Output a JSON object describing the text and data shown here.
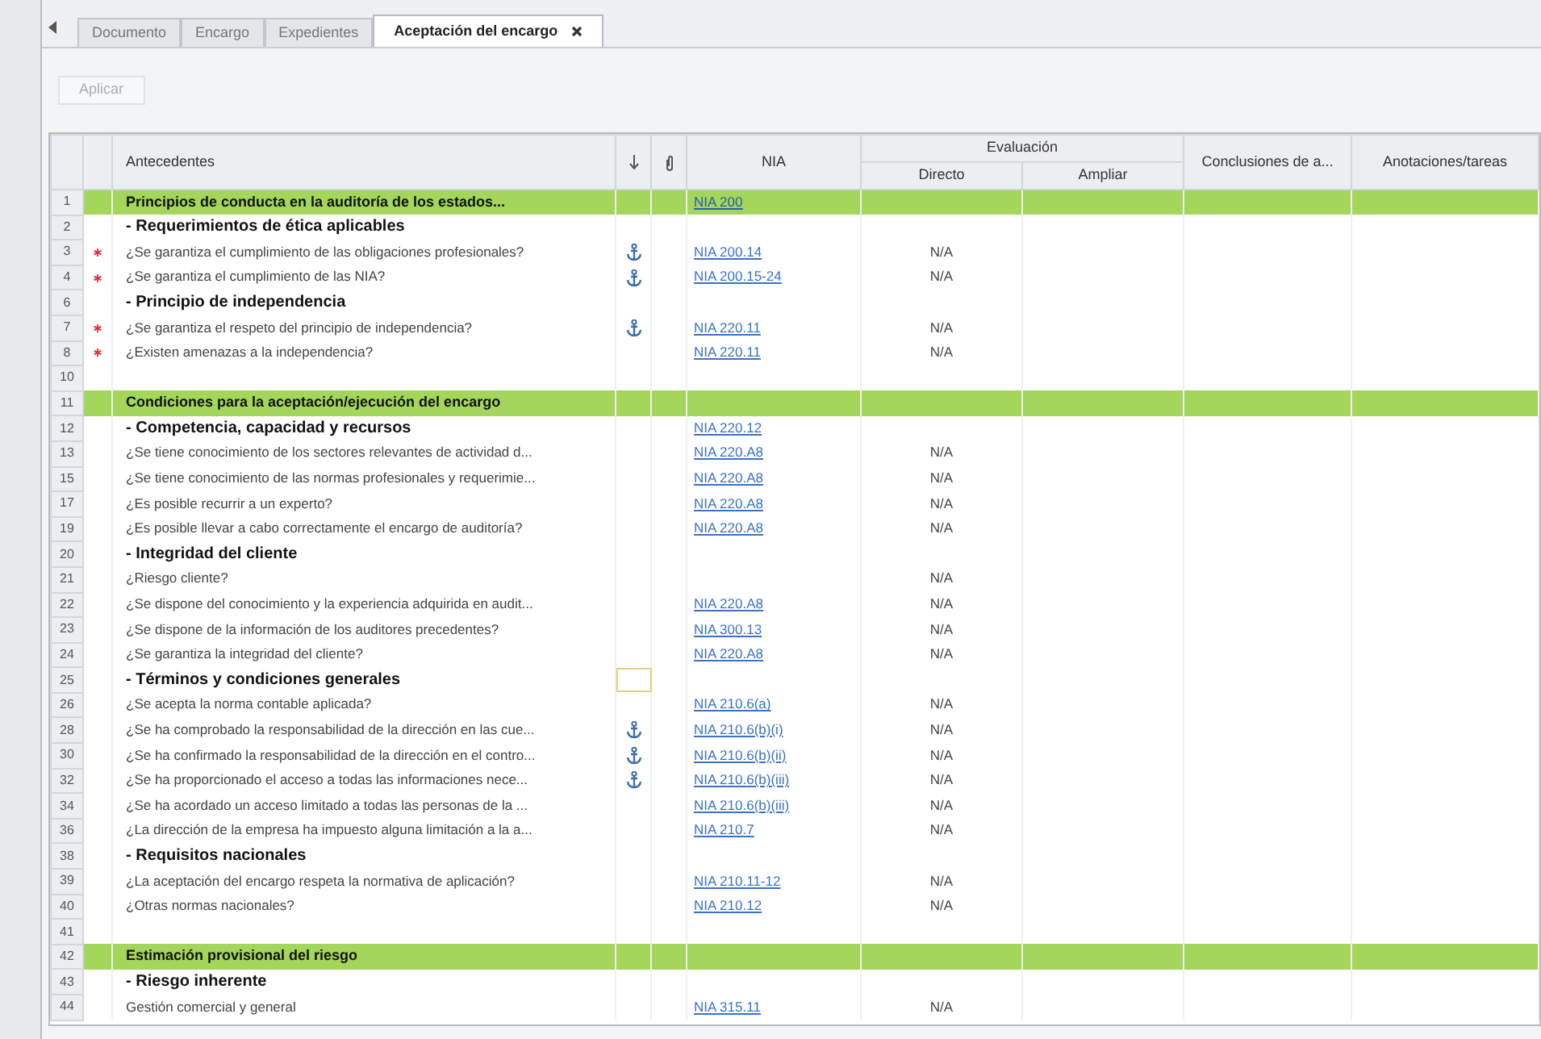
{
  "tabs": [
    {
      "label": "Documento",
      "selected": false
    },
    {
      "label": "Encargo",
      "selected": false
    },
    {
      "label": "Expedientes",
      "selected": false
    },
    {
      "label": "Aceptación del encargo",
      "selected": true
    }
  ],
  "toolbar": {
    "button": "Aplicar",
    "disabled": true
  },
  "table": {
    "columns": [
      "Antecedentes",
      "NIA",
      "Evaluación",
      "Directo",
      "Ampliar",
      "Conclusiones de a...",
      "Anotaciones/tareas"
    ],
    "rows": [
      {
        "kind": "section",
        "num": "1",
        "text": "Principios de conducta en la auditoría de los estados...",
        "nia": "NIA 200",
        "required": false,
        "anchor": false,
        "focused": false
      },
      {
        "kind": "group",
        "num": "2",
        "text": "- Requerimientos de ética aplicables",
        "required": false,
        "anchor": false,
        "focused": false
      },
      {
        "kind": "question",
        "num": "3",
        "text": "¿Se garantiza el cumplimiento de las obligaciones profesionales?",
        "nia": "NIA 200.14",
        "directo": "N/A",
        "required": true,
        "anchor": true,
        "focused": false
      },
      {
        "kind": "question",
        "num": "4",
        "text": "¿Se garantiza el cumplimiento de las NIA?",
        "nia": "NIA 200.15-24",
        "directo": "N/A",
        "required": true,
        "anchor": true,
        "focused": false
      },
      {
        "kind": "group",
        "num": "6",
        "text": "- Principio de independencia",
        "required": false,
        "anchor": false,
        "focused": false
      },
      {
        "kind": "question",
        "num": "7",
        "text": "¿Se garantiza el respeto del principio de independencia?",
        "nia": "NIA 220.11",
        "directo": "N/A",
        "required": true,
        "anchor": true,
        "focused": false
      },
      {
        "kind": "question",
        "num": "8",
        "text": "¿Existen amenazas a la independencia?",
        "nia": "NIA 220.11",
        "directo": "N/A",
        "required": true,
        "anchor": false,
        "focused": false
      },
      {
        "kind": "empty",
        "num": "10",
        "required": false,
        "anchor": false,
        "focused": false
      },
      {
        "kind": "section",
        "num": "11",
        "text": "Condiciones para la aceptación/ejecución del encargo",
        "required": false,
        "anchor": false,
        "focused": false
      },
      {
        "kind": "group",
        "num": "12",
        "text": "- Competencia, capacidad y recursos",
        "nia": "NIA 220.12",
        "required": false,
        "anchor": false,
        "focused": false
      },
      {
        "kind": "question",
        "num": "13",
        "text": "¿Se tiene conocimiento de los sectores relevantes de actividad d...",
        "nia": "NIA 220.A8",
        "directo": "N/A",
        "required": false,
        "anchor": false,
        "focused": false
      },
      {
        "kind": "question",
        "num": "15",
        "text": "¿Se tiene conocimiento de las normas profesionales y requerimie...",
        "nia": "NIA 220.A8",
        "directo": "N/A",
        "required": false,
        "anchor": false,
        "focused": false
      },
      {
        "kind": "question",
        "num": "17",
        "text": "¿Es posible recurrir a un experto?",
        "nia": "NIA 220.A8",
        "directo": "N/A",
        "required": false,
        "anchor": false,
        "focused": false
      },
      {
        "kind": "question",
        "num": "19",
        "text": "¿Es posible llevar a cabo correctamente el encargo de auditoría?",
        "nia": "NIA 220.A8",
        "directo": "N/A",
        "required": false,
        "anchor": false,
        "focused": false
      },
      {
        "kind": "group",
        "num": "20",
        "text": "- Integridad del cliente",
        "required": false,
        "anchor": false,
        "focused": false
      },
      {
        "kind": "question",
        "num": "21",
        "text": "¿Riesgo cliente?",
        "directo": "N/A",
        "required": false,
        "anchor": false,
        "focused": false
      },
      {
        "kind": "question",
        "num": "22",
        "text": "¿Se dispone del conocimiento y la experiencia adquirida en audit...",
        "nia": "NIA 220.A8",
        "directo": "N/A",
        "required": false,
        "anchor": false,
        "focused": false
      },
      {
        "kind": "question",
        "num": "23",
        "text": "¿Se dispone de la información de los auditores precedentes?",
        "nia": "NIA 300.13",
        "directo": "N/A",
        "required": false,
        "anchor": false,
        "focused": false
      },
      {
        "kind": "question",
        "num": "24",
        "text": "¿Se garantiza la integridad del cliente?",
        "nia": "NIA 220.A8",
        "directo": "N/A",
        "required": false,
        "anchor": false,
        "focused": false
      },
      {
        "kind": "group",
        "num": "25",
        "text": "- Términos y condiciones generales",
        "required": false,
        "anchor": false,
        "focused": true
      },
      {
        "kind": "question",
        "num": "26",
        "text": "¿Se acepta la norma contable aplicada?",
        "nia": "NIA 210.6(a)",
        "directo": "N/A",
        "required": false,
        "anchor": false,
        "focused": false
      },
      {
        "kind": "question",
        "num": "28",
        "text": "¿Se ha comprobado la responsabilidad de la dirección en las cue...",
        "nia": "NIA 210.6(b)(i)",
        "directo": "N/A",
        "required": false,
        "anchor": true,
        "focused": false
      },
      {
        "kind": "question",
        "num": "30",
        "text": "¿Se ha confirmado la responsabilidad de la dirección en el contro...",
        "nia": "NIA 210.6(b)(ii)",
        "directo": "N/A",
        "required": false,
        "anchor": true,
        "focused": false
      },
      {
        "kind": "question",
        "num": "32",
        "text": "¿Se ha proporcionado el acceso a todas las informaciones nece...",
        "nia": "NIA 210.6(b)(iii)",
        "directo": "N/A",
        "required": false,
        "anchor": true,
        "focused": false
      },
      {
        "kind": "question",
        "num": "34",
        "text": "¿Se ha acordado un acceso limitado a todas las personas de la ...",
        "nia": "NIA 210.6(b)(iii)",
        "directo": "N/A",
        "required": false,
        "anchor": false,
        "focused": false
      },
      {
        "kind": "question",
        "num": "36",
        "text": "¿La dirección de la empresa ha impuesto alguna limitación a la a...",
        "nia": "NIA 210.7",
        "directo": "N/A",
        "required": false,
        "anchor": false,
        "focused": false
      },
      {
        "kind": "group",
        "num": "38",
        "text": "- Requisitos nacionales",
        "required": false,
        "anchor": false,
        "focused": false
      },
      {
        "kind": "question",
        "num": "39",
        "text": "¿La aceptación del encargo respeta la normativa de aplicación?",
        "nia": "NIA 210.11-12",
        "directo": "N/A",
        "required": false,
        "anchor": false,
        "focused": false
      },
      {
        "kind": "question",
        "num": "40",
        "text": "¿Otras normas nacionales?",
        "nia": "NIA 210.12",
        "directo": "N/A",
        "required": false,
        "anchor": false,
        "focused": false
      },
      {
        "kind": "empty",
        "num": "41",
        "required": false,
        "anchor": false,
        "focused": false
      },
      {
        "kind": "section",
        "num": "42",
        "text": "Estimación provisional del riesgo",
        "required": false,
        "anchor": false,
        "focused": false
      },
      {
        "kind": "group",
        "num": "43",
        "text": "- Riesgo inherente",
        "required": false,
        "anchor": false,
        "focused": false
      },
      {
        "kind": "question",
        "num": "44",
        "text": "Gestión comercial y general",
        "nia": "NIA 315.11",
        "directo": "N/A",
        "required": false,
        "anchor": false,
        "focused": false
      }
    ]
  }
}
